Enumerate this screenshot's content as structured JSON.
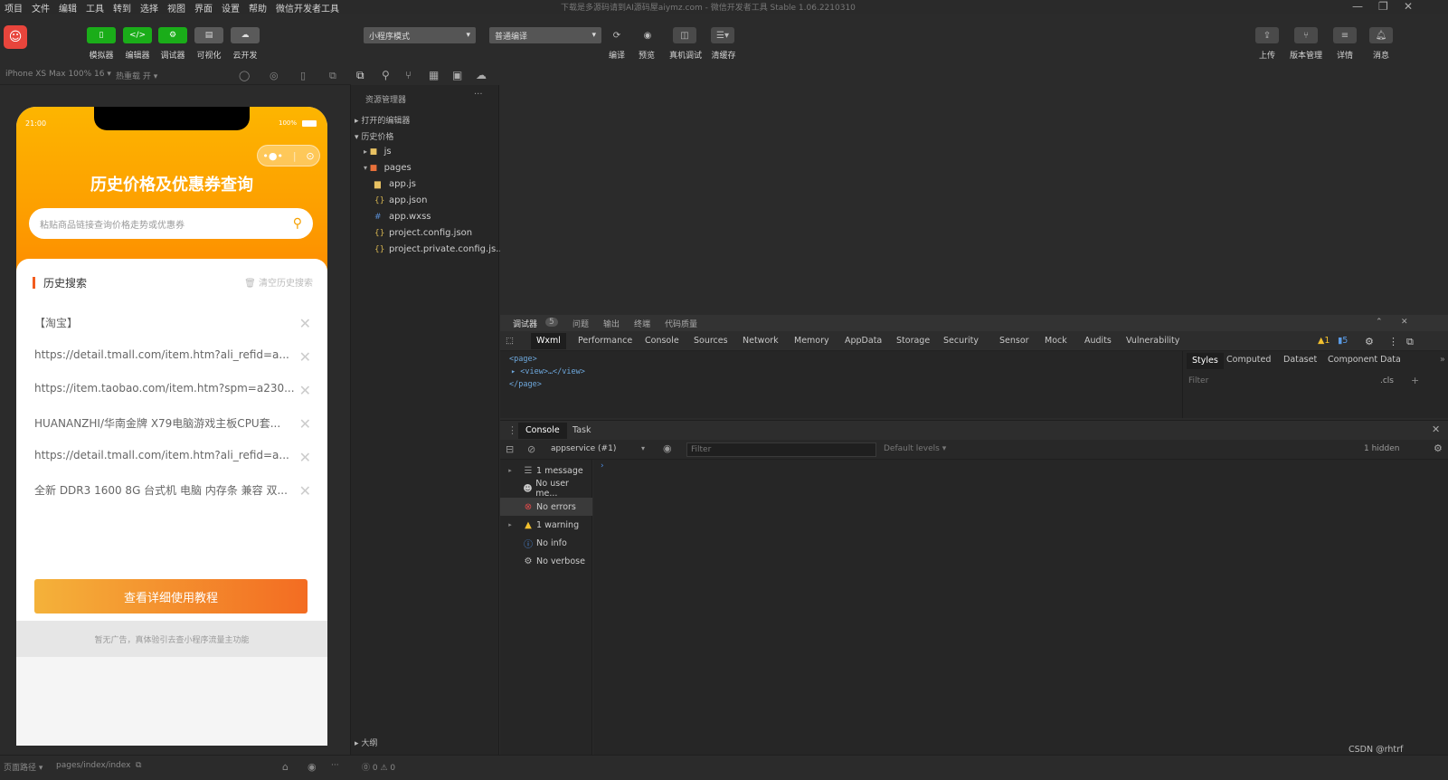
{
  "menubar": {
    "items": [
      "项目",
      "文件",
      "编辑",
      "工具",
      "转到",
      "选择",
      "视图",
      "界面",
      "设置",
      "帮助",
      "微信开发者工具"
    ],
    "window_title": "下载是多源码请到AI源码屋aiymz.com - 微信开发者工具 Stable 1.06.2210310"
  },
  "toolbar": {
    "simulator": "模拟器",
    "editor": "编辑器",
    "debugger": "调试器",
    "visual": "可视化",
    "cloud": "云开发",
    "mode_select": "小程序模式",
    "compile_select": "普通编译",
    "compile": "编译",
    "preview": "预览",
    "remote_debug": "真机调试",
    "clear_cache": "清缓存",
    "upload": "上传",
    "version": "版本管理",
    "detail": "详情",
    "message": "消息"
  },
  "simbar": {
    "device": "iPhone XS Max 100% 16 ▾",
    "hotreload": "热重载 开 ▾"
  },
  "phone": {
    "time": "21:00",
    "battery": "100%",
    "title": "历史价格及优惠券查询",
    "search_placeholder": "粘贴商品链接查询价格走势或优惠券",
    "history_title": "历史搜索",
    "clear_history": "清空历史搜索",
    "history": [
      "【淘宝】",
      "https://detail.tmall.com/item.htm?ali_refid=a...",
      "https://item.taobao.com/item.htm?spm=a230...",
      "HUANANZHI/华南金牌 X79电脑游戏主板CPU套...",
      "https://detail.tmall.com/item.htm?ali_refid=a...",
      "全新 DDR3 1600 8G 台式机 电脑 内存条 兼容 双..."
    ],
    "tutorial_button": "查看详细使用教程",
    "footer_note": "暂无广告，真体验引去查小程序流量主功能"
  },
  "explorer": {
    "title": "资源管理器",
    "open_editors": "打开的编辑器",
    "project": "历史价格",
    "items": [
      {
        "name": "js",
        "icon": "folder-icon"
      },
      {
        "name": "pages",
        "icon": "folder-icon"
      },
      {
        "name": "app.js",
        "icon": "js-file-icon"
      },
      {
        "name": "app.json",
        "icon": "json-file-icon"
      },
      {
        "name": "app.wxss",
        "icon": "wxss-file-icon"
      },
      {
        "name": "project.config.json",
        "icon": "json-file-icon"
      },
      {
        "name": "project.private.config.js...",
        "icon": "json-file-icon"
      }
    ],
    "outline": "大纲"
  },
  "debug_tabs": {
    "debugger": "调试器",
    "badge": "5",
    "problems": "问题",
    "output": "输出",
    "terminal": "终端",
    "code_quality": "代码质量"
  },
  "devtools_tabs": [
    "Wxml",
    "Performance",
    "Console",
    "Sources",
    "Network",
    "Memory",
    "AppData",
    "Storage",
    "Security",
    "Sensor",
    "Mock",
    "Audits",
    "Vulnerability"
  ],
  "devtools_counts": {
    "warnings": "1",
    "messages": "5"
  },
  "elements": {
    "line1": "<page>",
    "line2": "▸ <view>…</view>",
    "line3": "</page>"
  },
  "styles_tabs": [
    "Styles",
    "Computed",
    "Dataset",
    "Component Data"
  ],
  "styles_filter": "Filter",
  "styles_cls": ".cls",
  "console": {
    "tab_console": "Console",
    "tab_task": "Task",
    "context": "appservice (#1)",
    "filter_placeholder": "Filter",
    "levels": "Default levels ▾",
    "hidden": "1 hidden",
    "side": [
      {
        "label": "1 message",
        "icon": "list-icon",
        "arrow": true
      },
      {
        "label": "No user me...",
        "icon": "user-icon",
        "arrow": false
      },
      {
        "label": "No errors",
        "icon": "error-icon",
        "arrow": false
      },
      {
        "label": "1 warning",
        "icon": "warning-icon",
        "arrow": true
      },
      {
        "label": "No info",
        "icon": "info-icon",
        "arrow": false
      },
      {
        "label": "No verbose",
        "icon": "verbose-icon",
        "arrow": false
      }
    ]
  },
  "statusbar": {
    "path_label": "页面路径 ▾",
    "path": "pages/index/index",
    "counts": "⓪ 0 ⚠ 0"
  },
  "watermark": "CSDN @rhtrf",
  "colors": {
    "accent_green": "#1aad19",
    "phone_orange": "#fd9f00",
    "button_gradient_start": "#f4b23a",
    "button_gradient_end": "#f36c22"
  }
}
